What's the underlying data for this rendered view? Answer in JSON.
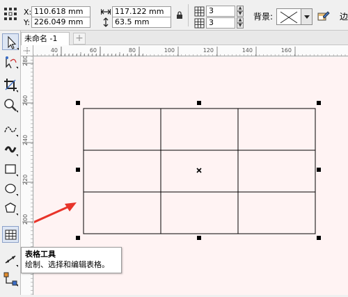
{
  "propbar": {
    "x_label": "X:",
    "x_value": "110.618 mm",
    "y_label": "Y:",
    "y_value": "226.049 mm",
    "width_value": "117.122 mm",
    "height_value": "63.5 mm",
    "cols_value": "3",
    "rows_value": "3",
    "background_label": "背景:",
    "edge_label": "边"
  },
  "tabs": {
    "document_title": "未命名 -1",
    "add_glyph": "+"
  },
  "hruler": {
    "ticks": [
      "40",
      "60",
      "80",
      "100",
      "120",
      "140",
      "160"
    ]
  },
  "vruler": {
    "ticks": [
      "280",
      "260",
      "240",
      "220",
      "200"
    ]
  },
  "tooltip": {
    "title": "表格工具",
    "description": "绘制、选择和编辑表格。"
  },
  "table": {
    "rows": 3,
    "columns": 3
  },
  "colors": {
    "canvas": "#fff3f3",
    "arrow": "#e8342a",
    "selection": "#000000"
  },
  "tools": [
    "pick-tool-icon",
    "shape-tool-icon",
    "crop-tool-icon",
    "zoom-tool-icon",
    "freehand-tool-icon",
    "artistic-media-icon",
    "rectangle-tool-icon",
    "ellipse-tool-icon",
    "polygon-tool-icon",
    "table-tool-icon",
    "dimension-tool-icon",
    "connector-tool-icon"
  ]
}
